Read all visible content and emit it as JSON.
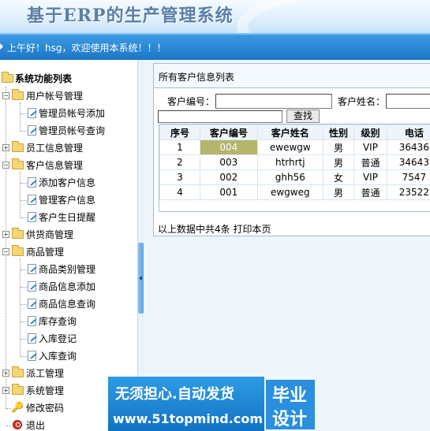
{
  "header": {
    "title": "基于ERP的生产管理系统"
  },
  "welcome": {
    "text": "上午好！hsg，欢迎使用本系统！！！"
  },
  "sidebar": {
    "root": "系统功能列表",
    "groups": [
      {
        "label": "用户帐号管理",
        "children": [
          "管理员帐号添加",
          "管理员帐号查询"
        ]
      },
      {
        "label": "员工信息管理"
      },
      {
        "label": "客户信息管理",
        "children": [
          "添加客户信息",
          "管理客户信息",
          "客户生日提醒"
        ]
      },
      {
        "label": "供货商管理"
      },
      {
        "label": "商品管理",
        "children": [
          "商品类别管理",
          "商品信息添加",
          "商品信息查询",
          "库存查询",
          "入库登记",
          "入库查询"
        ]
      },
      {
        "label": "派工管理"
      },
      {
        "label": "系统管理"
      }
    ],
    "change_password": "修改密码",
    "exit": "退出"
  },
  "panel": {
    "title": "所有客户信息列表",
    "search": {
      "customer_no_label": "客户编号：",
      "customer_name_label": "客户姓名：",
      "search_button": "查找"
    },
    "columns": [
      "序号",
      "客户编号",
      "客户姓名",
      "性别",
      "级别",
      "电话"
    ],
    "rows": [
      [
        "1",
        "004",
        "ewewgw",
        "男",
        "VIP",
        "36436"
      ],
      [
        "2",
        "003",
        "htrhrtj",
        "男",
        "普通",
        "34643"
      ],
      [
        "3",
        "002",
        "ghh56",
        "女",
        "VIP",
        "7547"
      ],
      [
        "4",
        "001",
        "ewgweg",
        "男",
        "普通",
        "23522"
      ]
    ],
    "footer": "以上数据中共4条  打印本页"
  },
  "watermark": {
    "line1": "无须担心.自动发货",
    "line2": "www.51topmind.com",
    "badge_line1": "毕业",
    "badge_line2": "设计"
  }
}
